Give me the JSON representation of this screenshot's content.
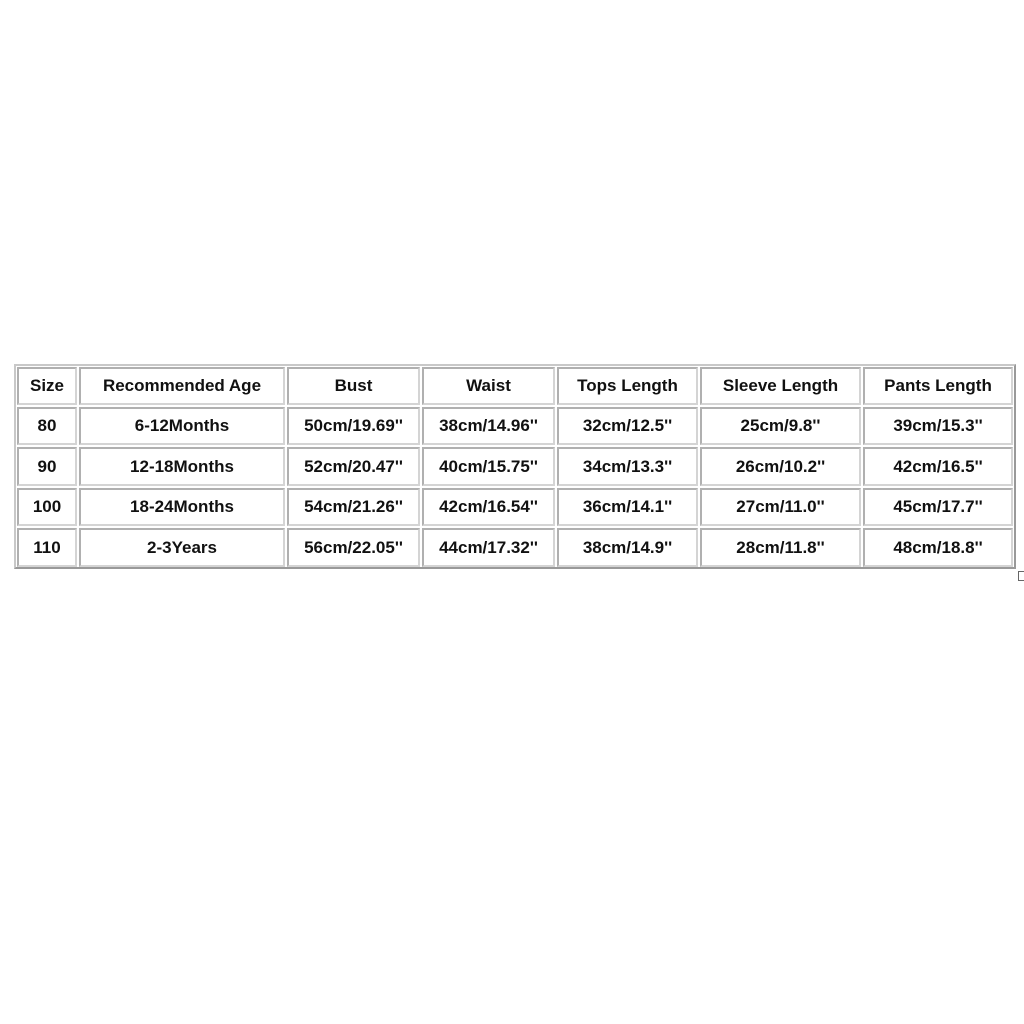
{
  "table": {
    "headers": [
      "Size",
      "Recommended Age",
      "Bust",
      "Waist",
      "Tops Length",
      "Sleeve Length",
      "Pants Length"
    ],
    "rows": [
      [
        "80",
        "6-12Months",
        "50cm/19.69''",
        "38cm/14.96''",
        "32cm/12.5''",
        "25cm/9.8''",
        "39cm/15.3''"
      ],
      [
        "90",
        "12-18Months",
        "52cm/20.47''",
        "40cm/15.75''",
        "34cm/13.3''",
        "26cm/10.2''",
        "42cm/16.5''"
      ],
      [
        "100",
        "18-24Months",
        "54cm/21.26''",
        "42cm/16.54''",
        "36cm/14.1''",
        "27cm/11.0''",
        "45cm/17.7''"
      ],
      [
        "110",
        "2-3Years",
        "56cm/22.05''",
        "44cm/17.32''",
        "38cm/14.9''",
        "28cm/11.8''",
        "48cm/18.8''"
      ]
    ]
  }
}
